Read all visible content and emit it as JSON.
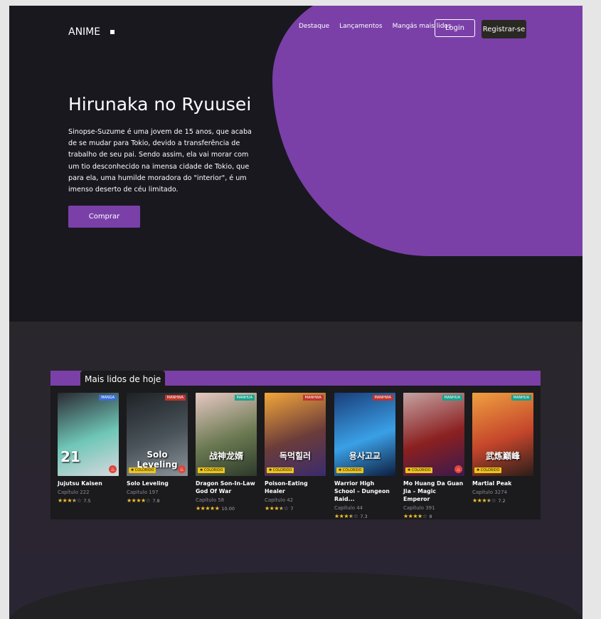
{
  "brand": {
    "name": "ANIME"
  },
  "nav": {
    "items": [
      "Destaque",
      "Lançamentos",
      "Mangás mais lidos"
    ],
    "login": "Login",
    "register": "Registrar-se"
  },
  "hero": {
    "title": "Hirunaka no Ryuusei",
    "synopsis": "Sinopse-Suzume é uma jovem de 15 anos, que acaba de se mudar para Tokio, devido a transferência de trabalho de seu pai. Sendo assim, ela vai morar com um tio desconhecido na imensa cidade de Tokio, que para ela, uma humilde moradora do \"interior\", é um imenso deserto de céu limitado.",
    "buy_label": "Comprar"
  },
  "popular": {
    "heading": "Mais lidos de hoje",
    "colored_label": "COLORIDO",
    "items": [
      {
        "title": "Jujutsu Kaisen",
        "chapter": "Capítulo 222",
        "rating": "7.5",
        "stars": 3.5,
        "type": "MANGA",
        "colored": false,
        "hot": true,
        "cover": [
          "#2b2a33",
          "#6fc7b7",
          "#d8d8de"
        ],
        "cover_text": "21"
      },
      {
        "title": "Solo Leveling",
        "chapter": "Capítulo 197",
        "rating": "7.8",
        "stars": 4,
        "type": "MANHWA",
        "colored": true,
        "hot": true,
        "cover": [
          "#1e2226",
          "#4a545a",
          "#8b949b"
        ],
        "cover_text": "Solo Leveling"
      },
      {
        "title": "Dragon Son-In-Law God Of War",
        "chapter": "Capítulo 58",
        "rating": "10.00",
        "stars": 5,
        "type": "MANHUA",
        "colored": true,
        "hot": false,
        "cover": [
          "#e7c8c4",
          "#6b7a52",
          "#2d3a2a"
        ],
        "cover_text": "战神龙婿"
      },
      {
        "title": "Poison-Eating Healer",
        "chapter": "Capítulo 42",
        "rating": "7",
        "stars": 3.5,
        "type": "MANHWA",
        "colored": true,
        "hot": false,
        "cover": [
          "#f3a63a",
          "#6b3c3a",
          "#3a2b6d"
        ],
        "cover_text": "독먹힐러"
      },
      {
        "title": "Warrior High School – Dungeon Raid...",
        "chapter": "Capítulo 44",
        "rating": "7.3",
        "stars": 3.5,
        "type": "MANHWA",
        "colored": true,
        "hot": false,
        "cover": [
          "#1a3d7a",
          "#3aa0e6",
          "#0d1d3e"
        ],
        "cover_text": "용사고교"
      },
      {
        "title": "Mo Huang Da Guan Jia – Magic Emperor",
        "chapter": "Capítulo 391",
        "rating": "8",
        "stars": 4,
        "type": "MANHUA",
        "colored": true,
        "hot": true,
        "cover": [
          "#c5a3a3",
          "#8b2020",
          "#3a1a4d"
        ],
        "cover_text": ""
      },
      {
        "title": "Martial Peak",
        "chapter": "Capítulo 3274",
        "rating": "7.2",
        "stars": 3.5,
        "type": "MANHUA",
        "colored": true,
        "hot": false,
        "cover": [
          "#f0a040",
          "#c4452b",
          "#2a1d1a"
        ],
        "cover_text": "武炼巅峰"
      }
    ]
  },
  "colors": {
    "accent": "#7a40a8",
    "background": "#19181f",
    "section": "#29272c"
  }
}
